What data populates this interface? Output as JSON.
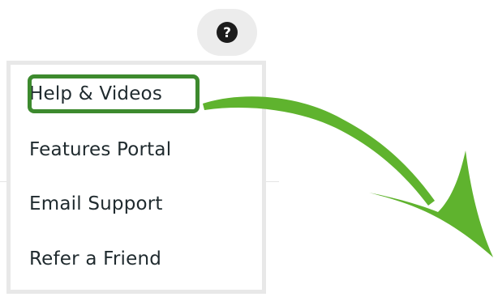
{
  "help_button": {
    "icon": "question-circle-icon",
    "icon_glyph": "?"
  },
  "menu": {
    "items": [
      {
        "label": "Help & Videos"
      },
      {
        "label": "Features Portal"
      },
      {
        "label": "Email Support"
      },
      {
        "label": "Refer a Friend"
      }
    ]
  },
  "annotation": {
    "highlight_color": "#3d8a2e",
    "arrow_color": "#5fb32e",
    "arrow": "green-arrow-icon"
  }
}
